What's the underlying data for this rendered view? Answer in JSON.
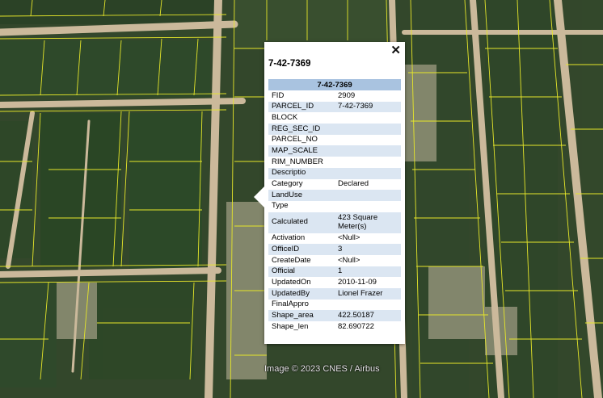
{
  "popup": {
    "title": "7-42-7369",
    "table_header": "7-42-7369",
    "close_icon": "close-icon",
    "rows": [
      {
        "key": "FID",
        "value": "2909"
      },
      {
        "key": "PARCEL_ID",
        "value": "7-42-7369"
      },
      {
        "key": "BLOCK",
        "value": ""
      },
      {
        "key": "REG_SEC_ID",
        "value": ""
      },
      {
        "key": "PARCEL_NO",
        "value": ""
      },
      {
        "key": "MAP_SCALE",
        "value": ""
      },
      {
        "key": "RIM_NUMBER",
        "value": ""
      },
      {
        "key": "Descriptio",
        "value": ""
      },
      {
        "key": "Category",
        "value": "Declared"
      },
      {
        "key": "LandUse",
        "value": ""
      },
      {
        "key": "Type",
        "value": ""
      },
      {
        "key": "Calculated",
        "value": "423 Square Meter(s)"
      },
      {
        "key": "Activation",
        "value": "<Null>"
      },
      {
        "key": "OfficeID",
        "value": "3"
      },
      {
        "key": "CreateDate",
        "value": "<Null>"
      },
      {
        "key": "Official",
        "value": "1"
      },
      {
        "key": "UpdatedOn",
        "value": "2010-11-09"
      },
      {
        "key": "UpdatedBy",
        "value": "Lionel Frazer"
      },
      {
        "key": "FinalAppro",
        "value": ""
      },
      {
        "key": "Shape_area",
        "value": "422.50187"
      },
      {
        "key": "Shape_len",
        "value": "82.690722"
      }
    ]
  },
  "attribution": "Image © 2023 CNES / Airbus",
  "colors": {
    "parcel_line": "#e6e62a",
    "road": "#c9b79a",
    "vegetation": "#2f4a2a",
    "header_bg": "#a9c3e0",
    "alt_row_bg": "#dbe6f2"
  }
}
